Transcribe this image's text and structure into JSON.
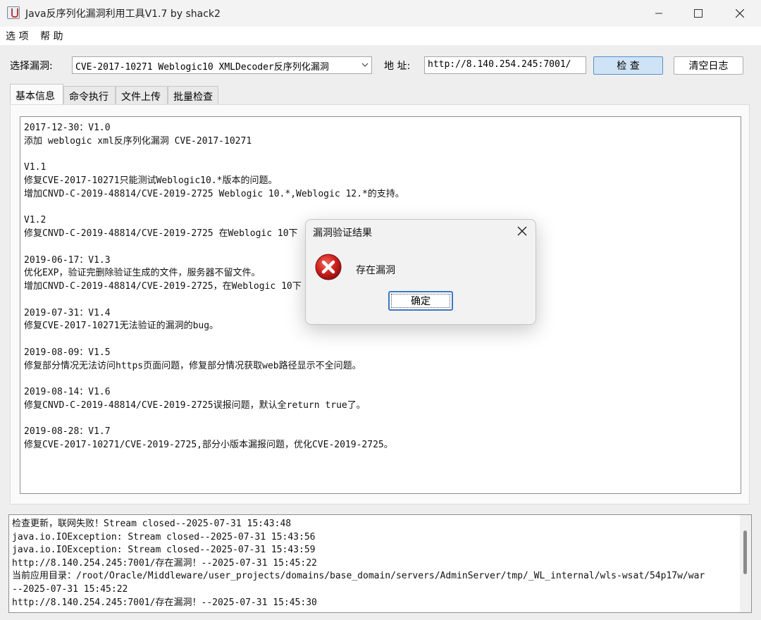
{
  "window": {
    "title": "Java反序列化漏洞利用工具V1.7 by shack2"
  },
  "menubar": {
    "items": [
      "选 项",
      "帮 助"
    ]
  },
  "toolbar": {
    "vuln_label": "选择漏洞:",
    "vuln_selected": "CVE-2017-10271 Weblogic10 XMLDecoder反序列化漏洞",
    "address_label": "地 址:",
    "address_value": "http://8.140.254.245:7001/",
    "check_button": "检 查",
    "clear_log_button": "清空日志"
  },
  "tabs": [
    {
      "label": "基本信息",
      "active": true
    },
    {
      "label": "命令执行",
      "active": false
    },
    {
      "label": "文件上传",
      "active": false
    },
    {
      "label": "批量检查",
      "active": false
    }
  ],
  "info_lines": [
    "2017-12-30：V1.0",
    "添加 weblogic xml反序列化漏洞 CVE-2017-10271",
    "",
    "V1.1",
    "修复CVE-2017-10271只能测试Weblogic10.*版本的问题。",
    "增加CNVD-C-2019-48814/CVE-2019-2725 Weblogic 10.*,Weblogic 12.*的支持。",
    "",
    "V1.2",
    "修复CNVD-C-2019-48814/CVE-2019-2725 在Weblogic 10下",
    "",
    "2019-06-17：V1.3",
    "优化EXP，验证完删除验证生成的文件，服务器不留文件。",
    "增加CNVD-C-2019-48814/CVE-2019-2725，在Weblogic 10下",
    "",
    "2019-07-31：V1.4",
    "修复CVE-2017-10271无法验证的漏洞的bug。",
    "",
    "2019-08-09：V1.5",
    "修复部分情况无法访问https页面问题，修复部分情况获取web路径显示不全问题。",
    "",
    "2019-08-14：V1.6",
    "修复CNVD-C-2019-48814/CVE-2019-2725误报问题，默认全return true了。",
    "",
    "2019-08-28：V1.7",
    "修复CVE-2017-10271/CVE-2019-2725,部分小版本漏报问题，优化CVE-2019-2725。"
  ],
  "log_lines": [
    "检查更新，联网失败！Stream closed--2025-07-31 15:43:48",
    "java.io.IOException: Stream closed--2025-07-31 15:43:56",
    "java.io.IOException: Stream closed--2025-07-31 15:43:59",
    "http://8.140.254.245:7001/存在漏洞！--2025-07-31 15:45:22",
    "当前应用目录：/root/Oracle/Middleware/user_projects/domains/base_domain/servers/AdminServer/tmp/_WL_internal/wls-wsat/54p17w/war",
    "--2025-07-31 15:45:22",
    "http://8.140.254.245:7001/存在漏洞！--2025-07-31 15:45:30"
  ],
  "dialog": {
    "title": "漏洞验证结果",
    "message": "存在漏洞",
    "ok_button": "确定",
    "icon": "error-icon"
  },
  "colors": {
    "primary_button": "#cfe3f6",
    "error_red": "#d0201c",
    "focus_blue": "#3b77c4"
  }
}
